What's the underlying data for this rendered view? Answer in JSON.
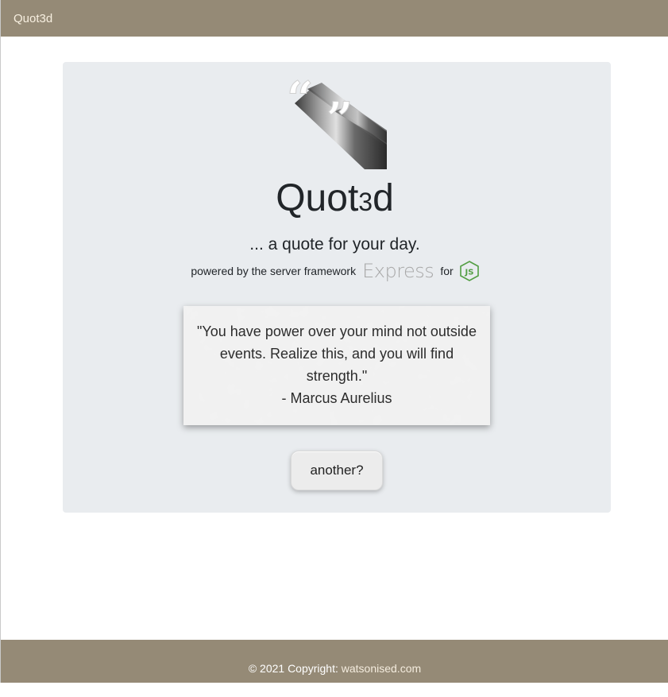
{
  "navbar": {
    "brand": "Quot3d"
  },
  "hero": {
    "logo_icon": "quote-marks-3d-icon",
    "title_prefix": "Quot",
    "title_3": "3",
    "title_suffix": "d",
    "tagline": "... a quote for your day.",
    "powered_by": "powered by the server framework",
    "express_label": "Express",
    "for_label": "for",
    "nodejs_icon": "nodejs-icon"
  },
  "quote": {
    "text": "\"You have power over your mind not outside events. Realize this, and you will find strength.\"",
    "author": "- Marcus Aurelius"
  },
  "actions": {
    "another_label": "another?"
  },
  "footer": {
    "copyright": "© 2021 Copyright:",
    "link_text": "watsonised.com"
  },
  "colors": {
    "bar": "#958a76",
    "jumbotron": "#e9ecef",
    "nodejs_green": "#539e43"
  }
}
